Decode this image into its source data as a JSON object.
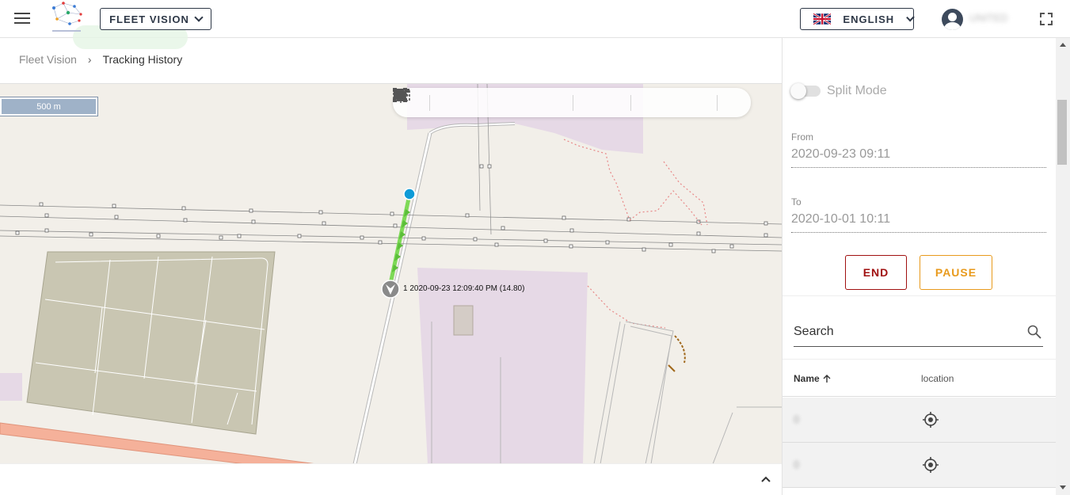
{
  "header": {
    "menu_icon": "hamburger-icon",
    "logo_icon": "network-logo-icon",
    "fleet_button_label": "FLEET VISION",
    "language_label": "ENGLISH",
    "language_flag_icon": "uk-flag-icon",
    "user_name": "UNITED",
    "fullscreen_icon": "fullscreen-icon"
  },
  "breadcrumb": {
    "items": [
      "Fleet Vision",
      "Tracking History"
    ],
    "separator": "›"
  },
  "map": {
    "scale_label": "500 m",
    "toolbar_icons": [
      "locate-icon",
      "flag-icon",
      "focus-icon",
      "fit-bounds-icon",
      "zoom-in-icon",
      "zoom-out-icon",
      "line-tool-icon",
      "select-area-icon",
      "polyline-icon",
      "rectangle-icon",
      "circle-icon",
      "arrow-icon"
    ],
    "marker_label": "1 2020-09-23 12:09:40 PM (14.80)",
    "route_color": "#7ed957",
    "start_point_color": "#0f9bd7"
  },
  "panel": {
    "split_mode_label": "Split Mode",
    "split_mode_on": false,
    "from_label": "From",
    "from_value": "2020-09-23 09:11",
    "to_label": "To",
    "to_value": "2020-10-01 10:11",
    "end_label": "END",
    "pause_label": "PAUSE",
    "search_placeholder": "Search",
    "columns": {
      "name": "Name",
      "location": "location"
    },
    "rows": [
      {
        "name": "0"
      },
      {
        "name": "0"
      }
    ]
  },
  "colors": {
    "end": "#a01010",
    "pause": "#e89a1c",
    "navy": "#2d3746"
  }
}
